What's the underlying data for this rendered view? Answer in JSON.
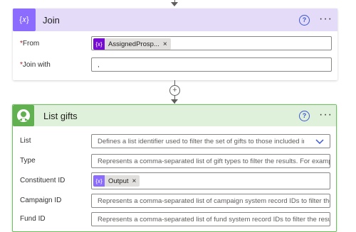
{
  "join_card": {
    "title": "Join",
    "icon": "data-operation-icon",
    "icon_glyph": "{𝑥}",
    "header_color": "#e3dbf7",
    "icon_color": "#8c6cff",
    "help_glyph": "?",
    "more_glyph": "···",
    "fields": {
      "from_label": "From",
      "from_required_mark": "*",
      "from_token_glyph": "{x}",
      "from_token_text": "AssignedProsp...",
      "from_token_remove": "×",
      "join_with_label": "Join with",
      "join_with_required_mark": "*",
      "join_with_value": ","
    }
  },
  "connector": {
    "add_glyph": "+"
  },
  "list_gifts_card": {
    "title": "List gifts",
    "icon": "blackbaud-user-icon",
    "header_color": "#dff1da",
    "border_color": "#6cbf5a",
    "icon_color": "#62b150",
    "help_glyph": "?",
    "more_glyph": "···",
    "fields": [
      {
        "label": "List",
        "placeholder": "Defines a list identifier used to filter the set of gifts to those included in the",
        "dropdown": true
      },
      {
        "label": "Type",
        "placeholder": "Represents a comma-separated list of gift types to filter the results. For exampl"
      },
      {
        "label": "Constituent ID",
        "token_glyph": "{x}",
        "token_text": "Output",
        "token_remove": "×"
      },
      {
        "label": "Campaign ID",
        "placeholder": "Represents a comma-separated list of campaign system record IDs to filter the"
      },
      {
        "label": "Fund ID",
        "placeholder": "Represents a comma-separated list of fund system record IDs to filter the resul"
      }
    ]
  }
}
